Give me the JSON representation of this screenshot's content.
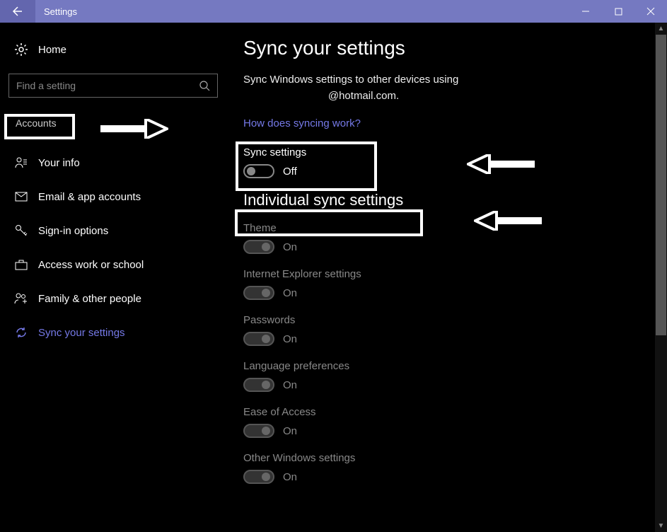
{
  "window": {
    "title": "Settings"
  },
  "sidebar": {
    "home_label": "Home",
    "search_placeholder": "Find a setting",
    "category": "Accounts",
    "items": [
      {
        "label": "Your info",
        "icon": "person-icon"
      },
      {
        "label": "Email & app accounts",
        "icon": "mail-icon"
      },
      {
        "label": "Sign-in options",
        "icon": "key-icon"
      },
      {
        "label": "Access work or school",
        "icon": "briefcase-icon"
      },
      {
        "label": "Family & other people",
        "icon": "people-icon"
      },
      {
        "label": "Sync your settings",
        "icon": "sync-icon"
      }
    ]
  },
  "main": {
    "title": "Sync your settings",
    "description_line1": "Sync Windows settings to other devices using",
    "description_line2": "@hotmail.com.",
    "link_text": "How does syncing work?",
    "sync_toggle": {
      "label": "Sync settings",
      "state": "Off"
    },
    "section_title": "Individual sync settings",
    "individual": [
      {
        "label": "Theme",
        "state": "On"
      },
      {
        "label": "Internet Explorer settings",
        "state": "On"
      },
      {
        "label": "Passwords",
        "state": "On"
      },
      {
        "label": "Language preferences",
        "state": "On"
      },
      {
        "label": "Ease of Access",
        "state": "On"
      },
      {
        "label": "Other Windows settings",
        "state": "On"
      }
    ]
  }
}
